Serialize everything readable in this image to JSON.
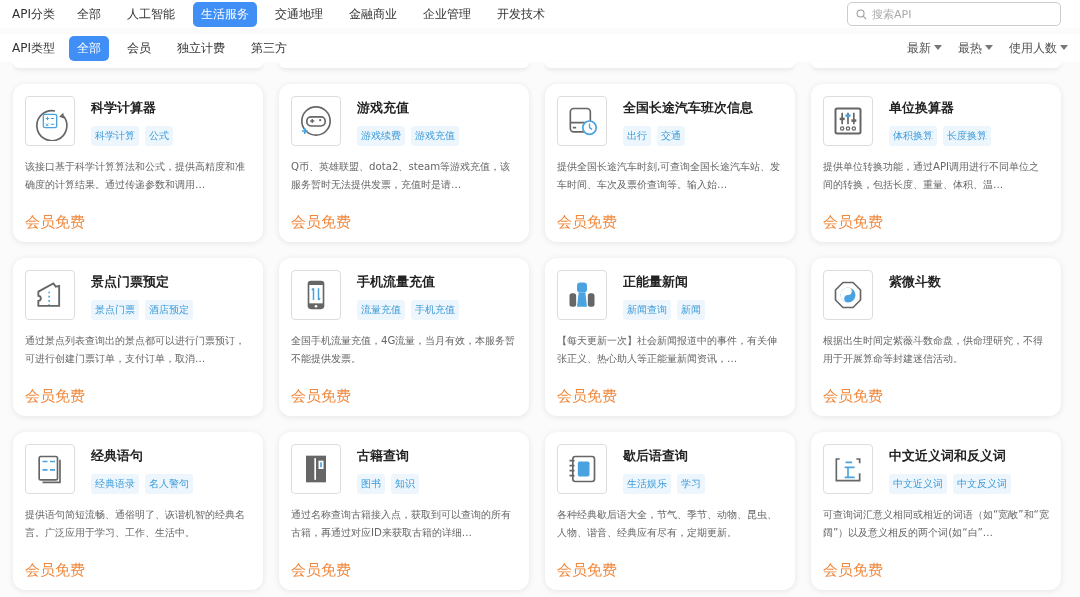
{
  "category_bar": {
    "label": "API分类",
    "tabs": [
      {
        "label": "全部",
        "selected": false
      },
      {
        "label": "人工智能",
        "selected": false
      },
      {
        "label": "生活服务",
        "selected": true
      },
      {
        "label": "交通地理",
        "selected": false
      },
      {
        "label": "金融商业",
        "selected": false
      },
      {
        "label": "企业管理",
        "selected": false
      },
      {
        "label": "开发技术",
        "selected": false
      }
    ],
    "search": {
      "placeholder": "搜索API"
    }
  },
  "type_bar": {
    "label": "API类型",
    "tabs": [
      {
        "label": "全部",
        "selected": true
      },
      {
        "label": "会员",
        "selected": false
      },
      {
        "label": "独立计费",
        "selected": false
      },
      {
        "label": "第三方",
        "selected": false
      }
    ],
    "sorts": [
      "最新",
      "最热",
      "使用人数"
    ]
  },
  "cards": [
    {
      "title": "科学计算器",
      "tags": [
        "科学计算",
        "公式"
      ],
      "description": "该接口基于科学计算算法和公式，提供高精度和准确度的计算结果。通过传递参数和调用…",
      "price": "会员免费"
    },
    {
      "title": "游戏充值",
      "tags": [
        "游戏续费",
        "游戏充值"
      ],
      "description": "Q币、英雄联盟、dota2、steam等游戏充值，该服务暂时无法提供发票，充值时是请…",
      "price": "会员免费"
    },
    {
      "title": "全国长途汽车班次信息",
      "tags": [
        "出行",
        "交通"
      ],
      "description": "提供全国长途汽车时刻,可查询全国长途汽车站、发车时间、车次及票价查询等。输入始…",
      "price": "会员免费"
    },
    {
      "title": "单位换算器",
      "tags": [
        "体积换算",
        "长度换算"
      ],
      "description": "提供单位转换功能，通过API调用进行不同单位之间的转换，包括长度、重量、体积、温…",
      "price": "会员免费"
    },
    {
      "title": "景点门票预定",
      "tags": [
        "景点门票",
        "酒店预定"
      ],
      "description": "通过景点列表查询出的景点都可以进行门票预订，可进行创建门票订单，支付订单，取消…",
      "price": "会员免费"
    },
    {
      "title": "手机流量充值",
      "tags": [
        "流量充值",
        "手机充值"
      ],
      "description": "全国手机流量充值，4G流量，当月有效，本服务暂不能提供发票。",
      "price": "会员免费"
    },
    {
      "title": "正能量新闻",
      "tags": [
        "新闻查询",
        "新闻"
      ],
      "description": "【每天更新一次】社会新闻报道中的事件，有关伸张正义、热心助人等正能量新闻资讯，…",
      "price": "会员免费"
    },
    {
      "title": "紫微斗数",
      "description": "根据出生时间定紫薇斗数命盘，供命理研究，不得用于开展算命等封建迷信活动。",
      "price": "会员免费"
    },
    {
      "title": "经典语句",
      "tags": [
        "经典语录",
        "名人警句"
      ],
      "description": "提供语句简短流畅、通俗明了、诙谐机智的经典名言。广泛应用于学习、工作、生活中。",
      "price": "会员免费"
    },
    {
      "title": "古籍查询",
      "tags": [
        "图书",
        "知识"
      ],
      "description": "通过名称查询古籍接入点，获取到可以查询的所有古籍，再通过对应ID来获取古籍的详细…",
      "price": "会员免费"
    },
    {
      "title": "歇后语查询",
      "tags": [
        "生活娱乐",
        "学习"
      ],
      "description": "各种经典歇后语大全，节气、季节、动物、昆虫、人物、谐音、经典应有尽有，定期更新。",
      "price": "会员免费"
    },
    {
      "title": "中文近义词和反义词",
      "tags": [
        "中文近义词",
        "中文反义词"
      ],
      "description": "可查询词汇意义相同或相近的词语（如“宽敞”和“宽阔”）以及意义相反的两个词(如“白”…",
      "price": "会员免费"
    }
  ]
}
